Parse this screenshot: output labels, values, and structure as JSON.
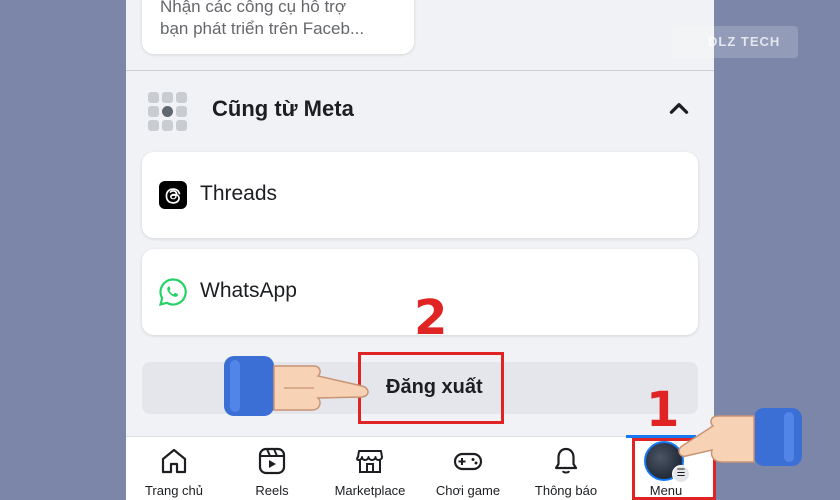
{
  "top_card": {
    "line1": "Nhận các công cụ hỗ trợ",
    "line2": "bạn phát triển trên Faceb..."
  },
  "section": {
    "title": "Cũng từ Meta"
  },
  "apps": [
    {
      "label": "Threads"
    },
    {
      "label": "WhatsApp"
    }
  ],
  "logout": {
    "label": "Đăng xuất"
  },
  "nav": [
    {
      "label": "Trang chủ"
    },
    {
      "label": "Reels"
    },
    {
      "label": "Marketplace"
    },
    {
      "label": "Chơi game"
    },
    {
      "label": "Thông báo"
    },
    {
      "label": "Menu"
    }
  ],
  "annotations": {
    "step1": "1",
    "step2": "2"
  },
  "watermark": "DLZ TECH",
  "colors": {
    "accent": "#1877f2",
    "highlight": "#e02424"
  }
}
